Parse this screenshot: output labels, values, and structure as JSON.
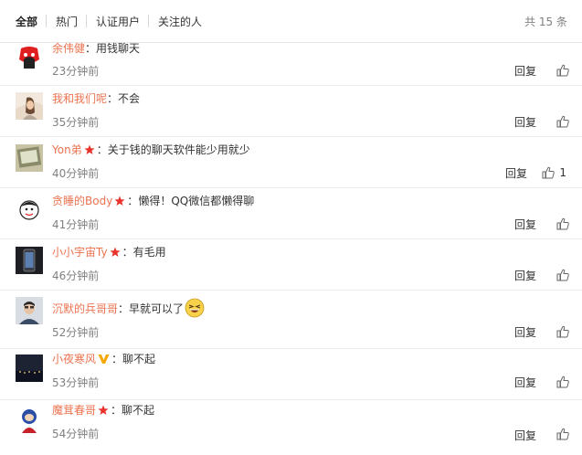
{
  "tabs": [
    {
      "label": "全部",
      "active": true
    },
    {
      "label": "热门",
      "active": false
    },
    {
      "label": "认证用户",
      "active": false
    },
    {
      "label": "关注的人",
      "active": false
    }
  ],
  "total_count": "共 15 条",
  "reply_label": "回复",
  "colon": "：",
  "accent_color": "#eb7350",
  "comments": [
    {
      "user": "余伟健",
      "badge": "",
      "text": "用钱聊天",
      "time": "23分钟前",
      "likes": ""
    },
    {
      "user": "我和我们呢",
      "badge": "",
      "text": "不会",
      "time": "35分钟前",
      "likes": ""
    },
    {
      "user": "Yon弟",
      "badge": "red-star",
      "text": "关于钱的聊天软件能少用就少",
      "time": "40分钟前",
      "likes": "1"
    },
    {
      "user": "贪睡的Body",
      "badge": "red-star",
      "text": "懒得！QQ微信都懒得聊",
      "time": "41分钟前",
      "likes": ""
    },
    {
      "user": "小小宇宙Ty",
      "badge": "red-star",
      "text": "有毛用",
      "time": "46分钟前",
      "likes": ""
    },
    {
      "user": "沉默的兵哥哥",
      "badge": "",
      "text": "早就可以了",
      "time": "52分钟前",
      "likes": "",
      "emoji": "laughing-emoji"
    },
    {
      "user": "小夜寒风",
      "badge": "yellow-v",
      "text": "聊不起",
      "time": "53分钟前",
      "likes": ""
    },
    {
      "user": "魔茸春哥",
      "badge": "red-star",
      "text": "聊不起",
      "time": "54分钟前",
      "likes": ""
    }
  ]
}
